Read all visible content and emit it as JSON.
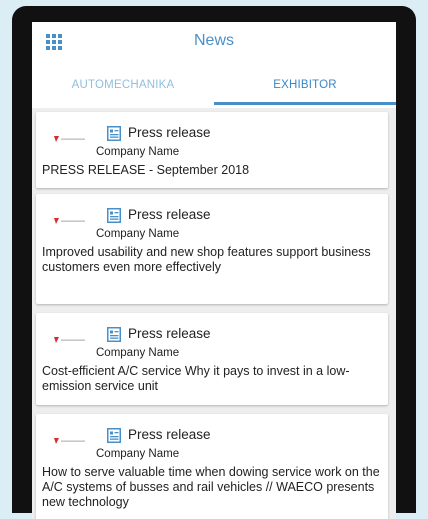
{
  "header": {
    "title": "News"
  },
  "tabs": [
    {
      "label": "AUTOMECHANIKA",
      "selected": false
    },
    {
      "label": "EXHIBITOR",
      "selected": true
    }
  ],
  "colors": {
    "accent": "#4a90c8",
    "tab_inactive": "#8fbfdd",
    "background": "#eeeeee"
  },
  "news": [
    {
      "type": "Press release",
      "company": "Company Name",
      "headline": "PRESS RELEASE - September 2018"
    },
    {
      "type": "Press release",
      "company": "Company Name",
      "headline": "Improved usability and new shop features support business customers even more effectively"
    },
    {
      "type": "Press release",
      "company": "Company Name",
      "headline": "Cost-efficient A/C service Why it pays to invest in a low-emission service unit"
    },
    {
      "type": "Press release",
      "company": "Company Name",
      "headline": "How to serve valuable time when dowing service work on the A/C systems of busses and rail vehicles // WAECO presents new technology"
    }
  ]
}
